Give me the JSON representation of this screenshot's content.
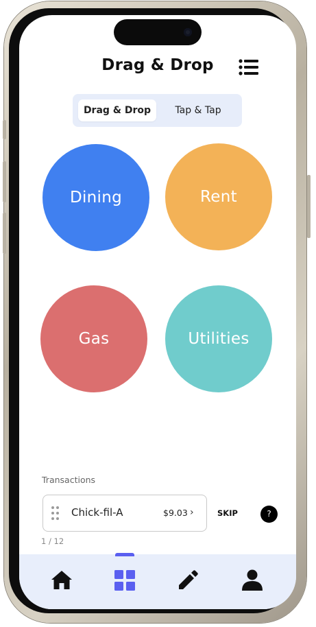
{
  "header": {
    "title": "Drag & Drop",
    "menu_icon": "list-icon"
  },
  "mode_toggle": {
    "options": [
      "Drag & Drop",
      "Tap & Tap"
    ],
    "selected": "Drag & Drop"
  },
  "categories": [
    {
      "label": "Dining",
      "color": "#4080f0"
    },
    {
      "label": "Rent",
      "color": "#f3b257"
    },
    {
      "label": "Gas",
      "color": "#db6f6f"
    },
    {
      "label": "Utilities",
      "color": "#70cccc"
    }
  ],
  "transactions": {
    "section_label": "Transactions",
    "current": {
      "name": "Chick-fil-A",
      "amount": "$9.03",
      "drag_icon": "drag-handle-icon",
      "chevron_icon": "chevron-right-icon"
    },
    "skip_label": "SKIP",
    "help_label": "?",
    "progress": "1 / 12"
  },
  "tab_bar": {
    "items": [
      {
        "icon": "home-icon",
        "active": false
      },
      {
        "icon": "grid-icon",
        "active": true
      },
      {
        "icon": "pencil-icon",
        "active": false
      },
      {
        "icon": "person-icon",
        "active": false
      }
    ],
    "active_color": "#5a5ff0"
  }
}
